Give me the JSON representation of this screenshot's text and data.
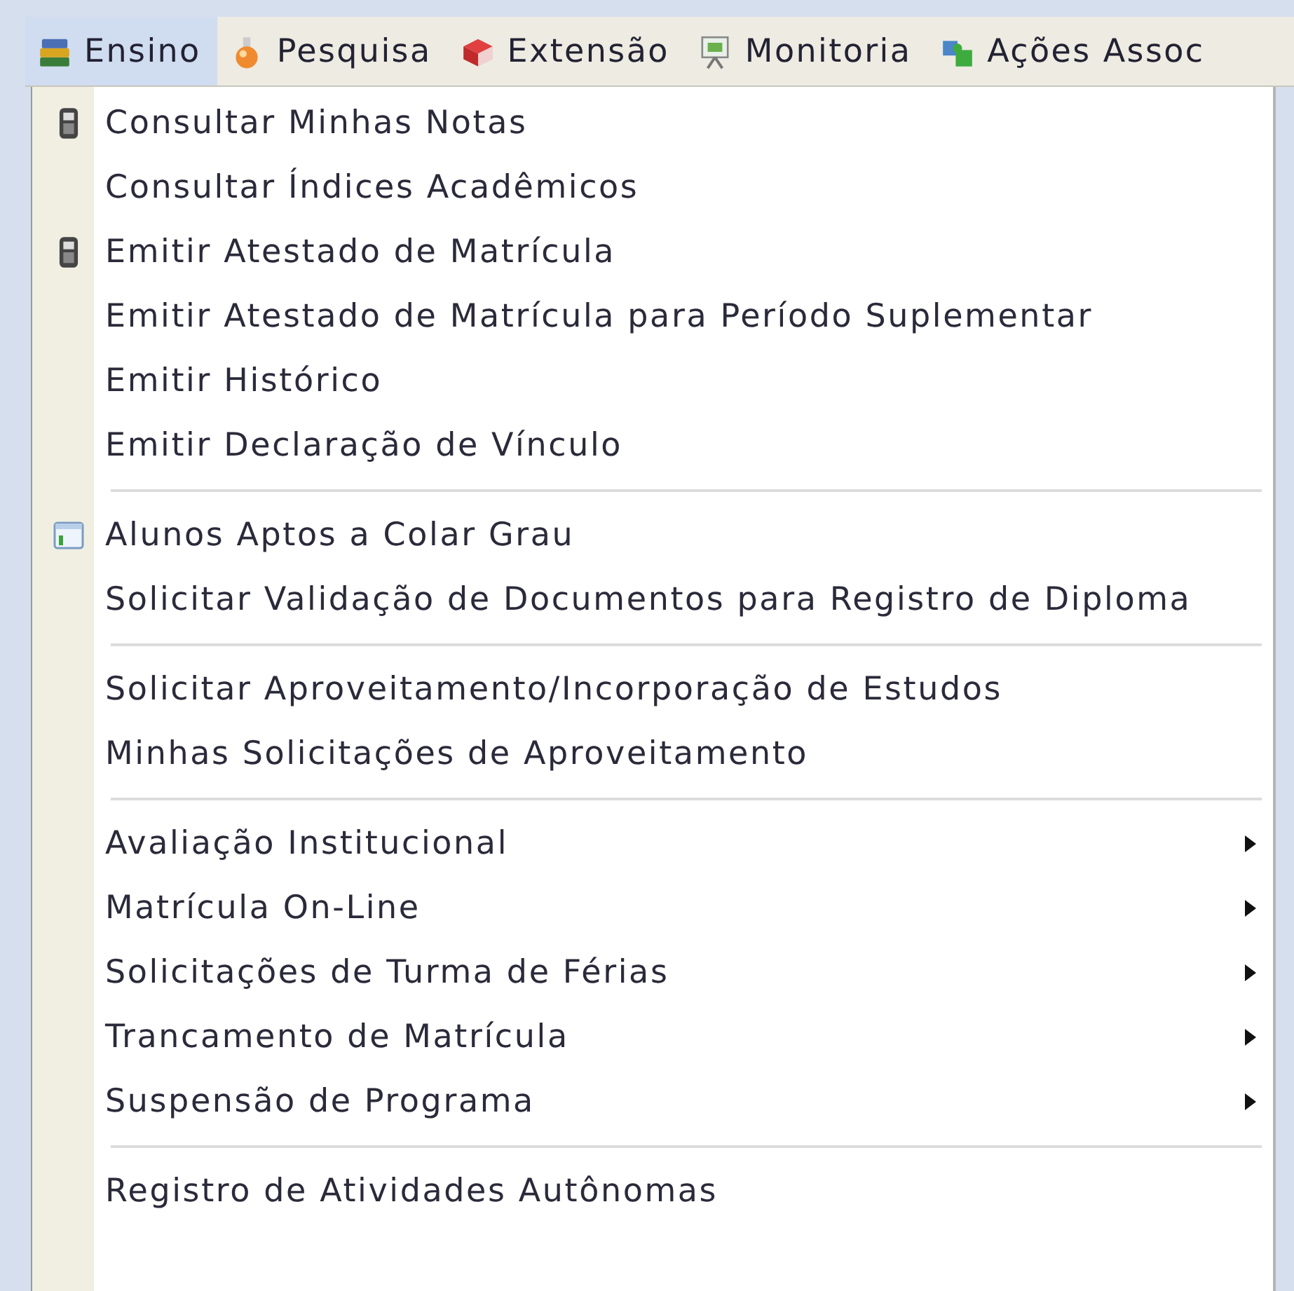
{
  "menubar": [
    {
      "label": "Ensino",
      "selected": true
    },
    {
      "label": "Pesquisa",
      "selected": false
    },
    {
      "label": "Extensão",
      "selected": false
    },
    {
      "label": "Monitoria",
      "selected": false
    },
    {
      "label": "Ações Assoc",
      "selected": false
    }
  ],
  "menu": {
    "sections": [
      {
        "items": [
          {
            "label": "Consultar Minhas Notas",
            "kind": "phone",
            "submenu": false
          },
          {
            "label": "Consultar Índices Acadêmicos",
            "kind": "plain",
            "submenu": false
          },
          {
            "label": "Emitir Atestado de Matrícula",
            "kind": "phone",
            "submenu": false
          },
          {
            "label": "Emitir Atestado de Matrícula para Período Suplementar",
            "kind": "plain",
            "submenu": false
          },
          {
            "label": "Emitir Histórico",
            "kind": "plain",
            "submenu": false
          },
          {
            "label": "Emitir Declaração de Vínculo",
            "kind": "plain",
            "submenu": false
          }
        ]
      },
      {
        "items": [
          {
            "label": "Alunos Aptos a Colar Grau",
            "kind": "window",
            "submenu": false
          },
          {
            "label": "Solicitar Validação de Documentos para Registro de Diploma",
            "kind": "plain",
            "submenu": false
          }
        ]
      },
      {
        "items": [
          {
            "label": "Solicitar Aproveitamento/Incorporação de Estudos",
            "kind": "plain",
            "submenu": false
          },
          {
            "label": "Minhas Solicitações de Aproveitamento",
            "kind": "plain",
            "submenu": false
          }
        ]
      },
      {
        "items": [
          {
            "label": "Avaliação Institucional",
            "kind": "plain",
            "submenu": true
          },
          {
            "label": "Matrícula On-Line",
            "kind": "plain",
            "submenu": true
          },
          {
            "label": "Solicitações de Turma de Férias",
            "kind": "plain",
            "submenu": true
          },
          {
            "label": "Trancamento de Matrícula",
            "kind": "plain",
            "submenu": true
          },
          {
            "label": "Suspensão de Programa",
            "kind": "plain",
            "submenu": true
          }
        ]
      },
      {
        "items": [
          {
            "label": "Registro de Atividades Autônomas",
            "kind": "plain",
            "submenu": false
          }
        ]
      }
    ]
  }
}
